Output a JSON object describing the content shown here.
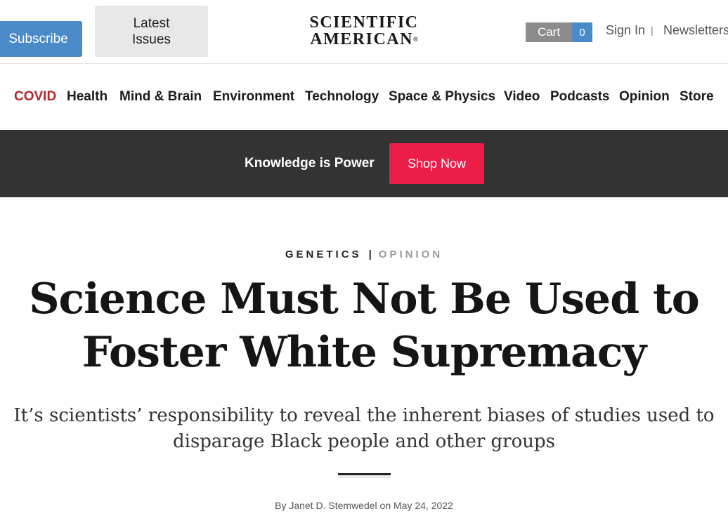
{
  "header": {
    "subscribe_label": "Subscribe",
    "latest_issues_label": "Latest Issues",
    "logo_line1": "SCIENTIFIC",
    "logo_line2": "AMERICAN",
    "logo_mark": "®",
    "cart_label": "Cart",
    "cart_count": "0",
    "sign_in_label": "Sign In",
    "separator": "|",
    "newsletters_label": "Newsletters"
  },
  "nav": {
    "items": [
      "COVID",
      "Health",
      "Mind & Brain",
      "Environment",
      "Technology",
      "Space & Physics",
      "Video",
      "Podcasts",
      "Opinion",
      "Store"
    ]
  },
  "banner": {
    "text": "Knowledge is Power",
    "button_label": "Shop Now"
  },
  "article": {
    "category": "GENETICS",
    "divider": "|",
    "section": "OPINION",
    "headline_line1": "Science Must Not Be Used to",
    "headline_line2": "Foster White Supremacy",
    "dek": "It’s scientists’ responsibility to reveal the inherent biases of studies used to disparage Black people and other groups",
    "byline": "By Janet D. Stemwedel on May 24, 2022"
  },
  "colors": {
    "subscribe": "#4a8ac9",
    "covid": "#b3262e",
    "banner_bg": "#333333",
    "shop_button": "#eb1e49"
  }
}
